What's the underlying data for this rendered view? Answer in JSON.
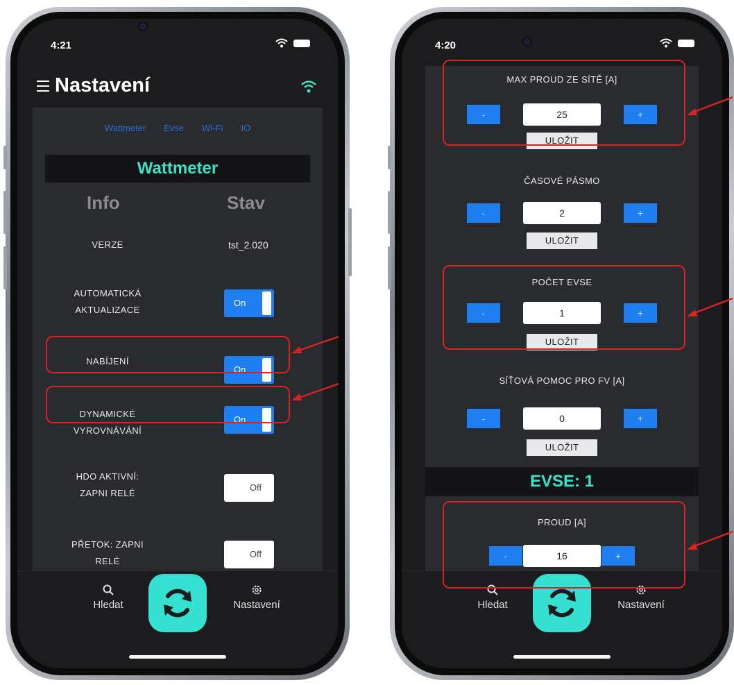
{
  "left_phone": {
    "status_time": "4:21",
    "title": "Nastavení",
    "tabs": [
      "Wattmeter",
      "Evse",
      "Wi-Fi",
      "IO"
    ],
    "section_title": "Wattmeter",
    "col_info": "Info",
    "col_stav": "Stav",
    "rows": [
      {
        "label_l1": "VERZE",
        "label_l2": "",
        "value": "tst_2.020"
      },
      {
        "label_l1": "AUTOMATICKÁ",
        "label_l2": "AKTUALIZACE",
        "value": "On"
      },
      {
        "label_l1": "NABÍJENÍ",
        "label_l2": "",
        "value": "On"
      },
      {
        "label_l1": "DYNAMICKÉ",
        "label_l2": "VYROVNÁVÁNÍ",
        "value": "On"
      },
      {
        "label_l1": "HDO AKTIVNÍ:",
        "label_l2": "ZAPNI RELÉ",
        "value": "Off"
      },
      {
        "label_l1": "PŘETOK: ZAPNI",
        "label_l2": "RELÉ",
        "value": "Off"
      }
    ]
  },
  "right_phone": {
    "status_time": "4:20",
    "settings": [
      {
        "title": "MAX PROUD ZE SÍTĚ [A]",
        "value": "25"
      },
      {
        "title": "ČASOVÉ PÁSMO",
        "value": "2"
      },
      {
        "title": "POČET EVSE",
        "value": "1"
      },
      {
        "title": "SÍŤOVÁ POMOC PRO FV [A]",
        "value": "0"
      }
    ],
    "evse_section": "EVSE: 1",
    "evse_setting": {
      "title": "PROUD [A]",
      "value": "16"
    }
  },
  "stepper": {
    "minus": "-",
    "plus": "+",
    "save": "ULOŽIT"
  },
  "tabbar": {
    "search": "Hledat",
    "settings": "Nastavení"
  },
  "colors": {
    "accent_teal": "#3ee0c8",
    "toggle_blue": "#1f7ff0",
    "highlight_red": "#d42424",
    "refresh_button": "#36e0d0"
  },
  "icons": [
    "hamburger-icon",
    "wifi-icon",
    "battery-icon",
    "search-icon",
    "gear-icon",
    "refresh-icon",
    "arrow-icon"
  ]
}
